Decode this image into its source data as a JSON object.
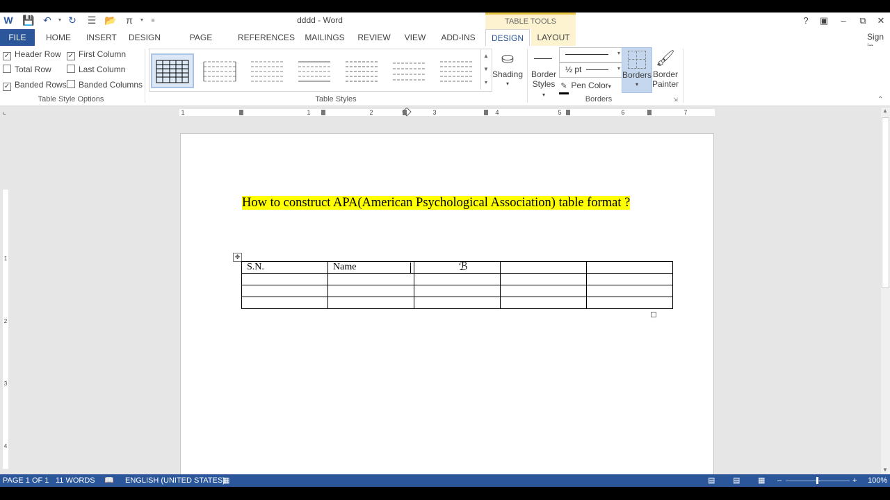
{
  "window": {
    "title": "dddd - Word",
    "contextual_group": "TABLE TOOLS",
    "sign_in": "Sign in"
  },
  "tabs": [
    "FILE",
    "HOME",
    "INSERT",
    "DESIGN",
    "PAGE LAYOUT",
    "REFERENCES",
    "MAILINGS",
    "REVIEW",
    "VIEW",
    "ADD-INS",
    "DESIGN",
    "LAYOUT"
  ],
  "table_style_options": {
    "items": [
      {
        "label": "Header Row",
        "checked": true
      },
      {
        "label": "First Column",
        "checked": true
      },
      {
        "label": "Total Row",
        "checked": false
      },
      {
        "label": "Last Column",
        "checked": false
      },
      {
        "label": "Banded Rows",
        "checked": true
      },
      {
        "label": "Banded Columns",
        "checked": false
      }
    ],
    "group_label": "Table Style Options"
  },
  "table_styles": {
    "group_label": "Table Styles"
  },
  "shading": {
    "label": "Shading"
  },
  "borders_group": {
    "border_styles_line1": "Border",
    "border_styles_line2": "Styles",
    "pen_weight": "½ pt",
    "pen_color": "Pen Color",
    "borders": "Borders",
    "border_painter_line1": "Border",
    "border_painter_line2": "Painter",
    "group_label": "Borders"
  },
  "ruler": {
    "labels": [
      "1",
      "1",
      "2",
      "3",
      "4",
      "5",
      "6",
      "7"
    ]
  },
  "document": {
    "heading": "How  to construct APA(American Psychological Association)  table format ?",
    "table": [
      [
        "S.N.",
        "Name",
        "",
        "",
        ""
      ],
      [
        "",
        "",
        "",
        "",
        ""
      ],
      [
        "",
        "",
        "",
        "",
        ""
      ],
      [
        "",
        "",
        "",
        "",
        ""
      ]
    ]
  },
  "status": {
    "page": "PAGE 1 OF 1",
    "words": "11 WORDS",
    "language": "ENGLISH (UNITED STATES)",
    "zoom": "100%"
  },
  "colors": {
    "accent": "#2b579a",
    "highlight": "#ffff00",
    "contextual": "#fdf3d0"
  }
}
